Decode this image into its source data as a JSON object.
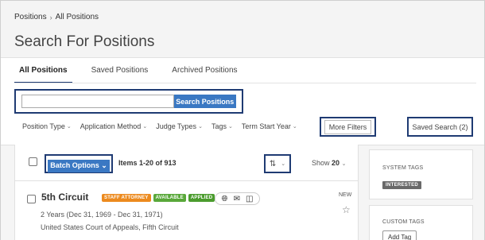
{
  "breadcrumb": {
    "first": "Positions",
    "separator": "›",
    "second": "All Positions"
  },
  "page_title": "Search For Positions",
  "tabs": [
    {
      "label": "All Positions",
      "active": true
    },
    {
      "label": "Saved Positions",
      "active": false
    },
    {
      "label": "Archived Positions",
      "active": false
    }
  ],
  "search": {
    "placeholder": "",
    "value": "",
    "button_label": "Search Positions"
  },
  "filters": [
    {
      "label": "Position Type"
    },
    {
      "label": "Application Method"
    },
    {
      "label": "Judge Types"
    },
    {
      "label": "Tags"
    },
    {
      "label": "Term Start Year"
    }
  ],
  "more_filters_label": "More Filters",
  "saved_search_label": "Saved Search (2)",
  "toolbar": {
    "batch_label": "Batch Options",
    "items_text": "Items 1-20 of 913",
    "show_label": "Show",
    "show_value": "20"
  },
  "listing": {
    "title": "5th Circuit",
    "badges": [
      {
        "label": "STAFF ATTORNEY",
        "color": "#ec8a1e"
      },
      {
        "label": "AVAILABLE",
        "color": "#59a83a"
      },
      {
        "label": "APPLIED",
        "color": "#4b9c2e"
      }
    ],
    "new_label": "NEW",
    "dates": "2 Years (Dec 31, 1969 - Dec 31, 1971)",
    "court": "United States Court of Appeals, Fifth Circuit"
  },
  "sidebar": {
    "system_tags_label": "SYSTEM TAGS",
    "interested_tag": "INTERESTED",
    "custom_tags_label": "CUSTOM TAGS",
    "add_tag_label": "Add Tag"
  },
  "colors": {
    "accent": "#1f3b73",
    "button": "#3a78c3"
  }
}
